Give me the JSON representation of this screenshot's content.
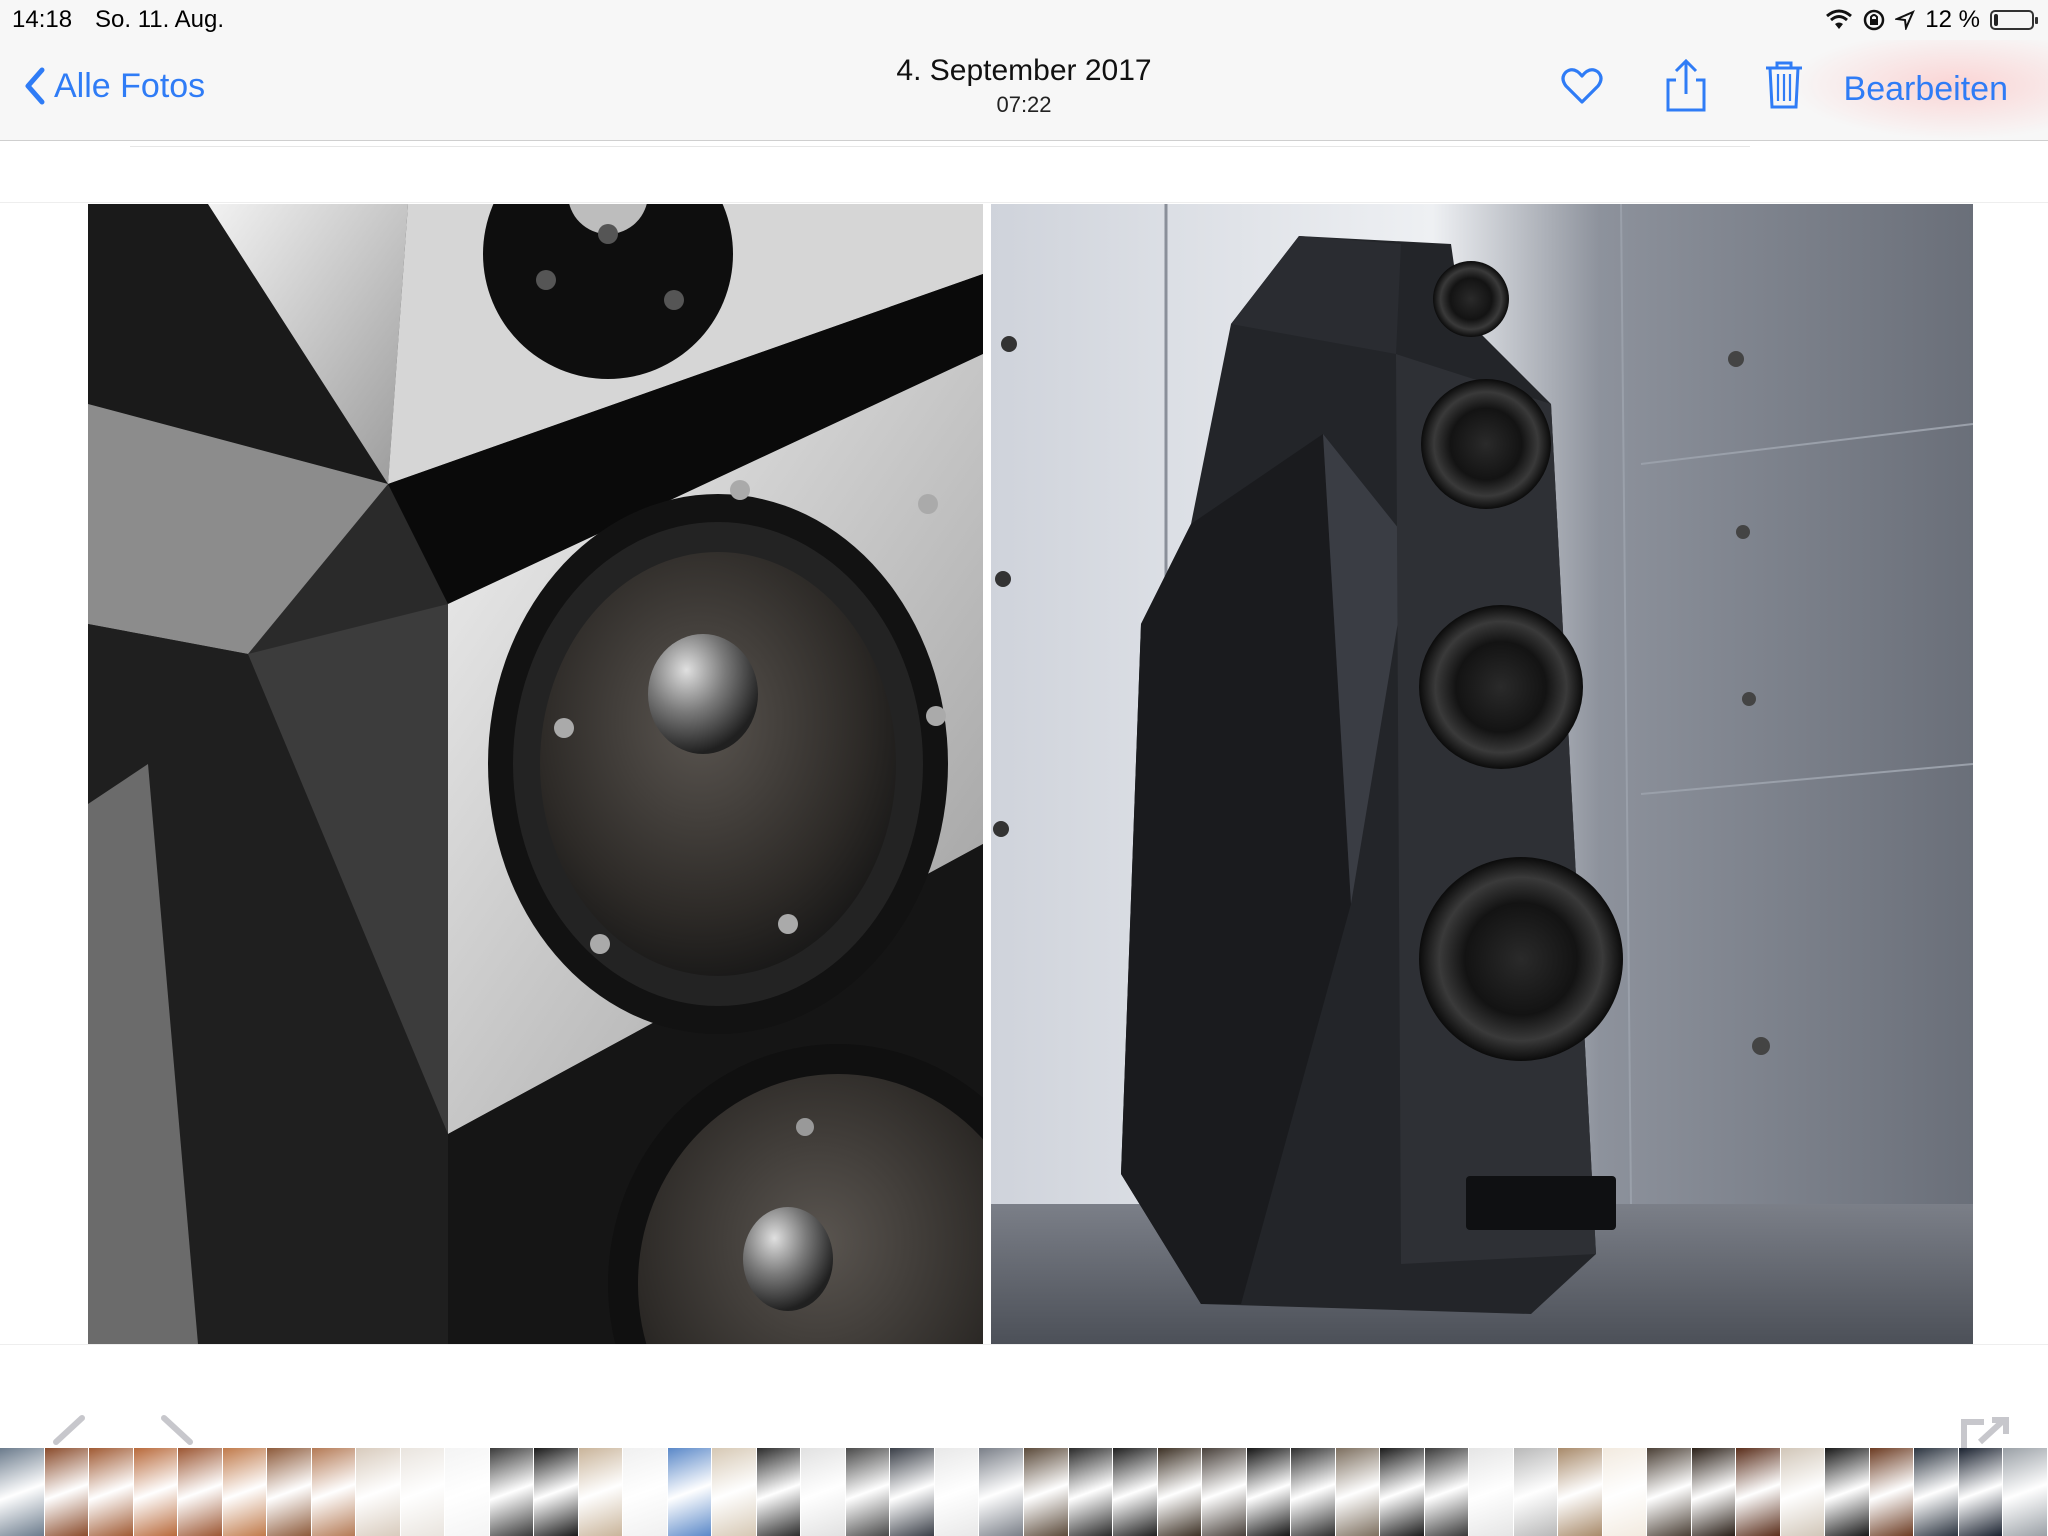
{
  "status_bar": {
    "time": "14:18",
    "date": "So. 11. Aug.",
    "battery": "12 %",
    "battery_level": 0.12,
    "icons": [
      "wifi-icon",
      "rotation-lock-icon",
      "location-icon",
      "battery-icon"
    ]
  },
  "nav": {
    "back_label": "Alle Fotos",
    "title": "4. September 2017",
    "subtitle": "07:22",
    "edit_label": "Bearbeiten",
    "icons": [
      "chevron-left-icon",
      "heart-icon",
      "share-icon",
      "trash-icon"
    ],
    "accent_color": "#2f7cf6"
  },
  "photo": {
    "left_panel": "speaker-detail-closeup",
    "right_panel": "speaker-full-view"
  },
  "filmstrip": {
    "nav_icons": [
      "chevron-left-icon",
      "chevron-right-icon",
      "expand-icon"
    ],
    "thumbnail_count": 46
  }
}
